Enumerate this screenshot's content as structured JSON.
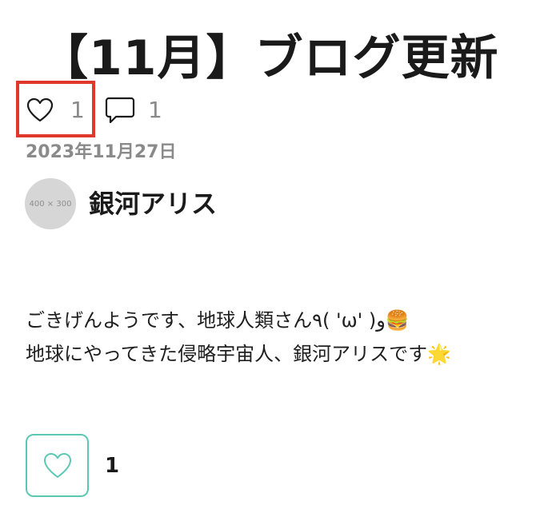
{
  "article": {
    "title": "【11月】ブログ更新",
    "date": "2023年11月27日"
  },
  "meta": {
    "like_count": "1",
    "comment_count": "1",
    "like_icon": "heart-outline",
    "comment_icon": "speech-bubble-outline"
  },
  "author": {
    "name": "銀河アリス",
    "avatar_placeholder": "400 × 300"
  },
  "body": {
    "line1": "ごきげんようです、地球人類さん٩( 'ω' )و🍔",
    "line2": "地球にやってきた侵略宇宙人、銀河アリスです🌟"
  },
  "like_button": {
    "count": "1",
    "icon": "heart-outline",
    "accent_color": "#5cc7b2"
  },
  "annotation": {
    "highlight_color": "#e0382a"
  }
}
